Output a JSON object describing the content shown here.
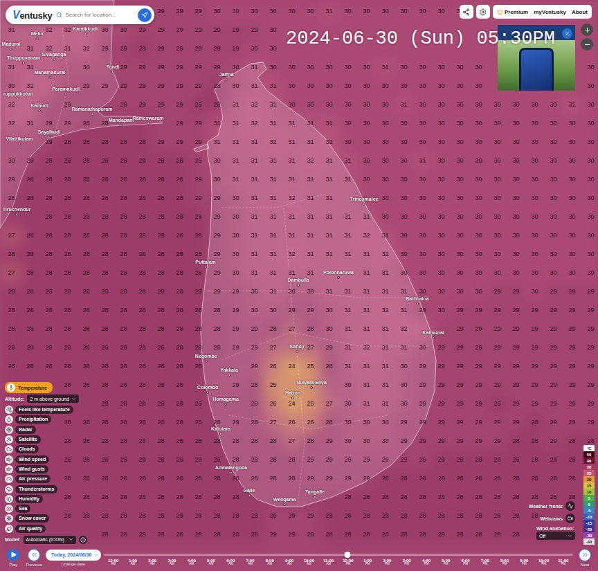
{
  "header": {
    "logo": "Ventusky",
    "search_placeholder": "Search for location...",
    "nav": [
      {
        "label": "Premium",
        "kind": "premium"
      },
      {
        "label": "myVentusky",
        "kind": "link"
      },
      {
        "label": "About",
        "kind": "link"
      }
    ]
  },
  "datetime": "2024-06-30 (Sun) 05:30PM",
  "layers": {
    "items": [
      {
        "label": "Temperature",
        "selected": true
      },
      {
        "label": "Feels like temperature",
        "selected": false
      },
      {
        "label": "Precipitation",
        "selected": false
      },
      {
        "label": "Radar",
        "selected": false
      },
      {
        "label": "Satellite",
        "selected": false
      },
      {
        "label": "Clouds",
        "selected": false
      },
      {
        "label": "Wind speed",
        "selected": false
      },
      {
        "label": "Wind gusts",
        "selected": false
      },
      {
        "label": "Air pressure",
        "selected": false
      },
      {
        "label": "Thunderstorms",
        "selected": false
      },
      {
        "label": "Humidity",
        "selected": false
      },
      {
        "label": "Sea",
        "selected": false
      },
      {
        "label": "Snow cover",
        "selected": false
      },
      {
        "label": "Air quality",
        "selected": false
      }
    ],
    "altitude": {
      "label": "Altitude:",
      "value": "2 m above ground"
    },
    "model": {
      "label": "Model:",
      "value": "Automatic (ICON)"
    }
  },
  "legend": {
    "unit": "°C",
    "items": [
      {
        "label": "50",
        "color": "#3d0716"
      },
      {
        "label": "40",
        "color": "#6b1330"
      },
      {
        "label": "30",
        "color": "#a13c63"
      },
      {
        "label": "25",
        "color": "#c9596a"
      },
      {
        "label": "20",
        "color": "#e39a3c"
      },
      {
        "label": "15",
        "color": "#d6c13a"
      },
      {
        "label": "10",
        "color": "#a5c43b"
      },
      {
        "label": "5",
        "color": "#4caf45"
      },
      {
        "label": "0",
        "color": "#2e9d7c"
      },
      {
        "label": "-5",
        "color": "#3a86c4"
      },
      {
        "label": "-10",
        "color": "#3d63b3"
      },
      {
        "label": "-15",
        "color": "#2f3f9e"
      },
      {
        "label": "-20",
        "color": "#4b2d8f"
      },
      {
        "label": "-30",
        "color": "#9a3fa6"
      },
      {
        "label": "-40",
        "color": "#e6e6e6"
      }
    ]
  },
  "map_controls": {
    "weather_fronts": "Weather fronts",
    "webcams": "Webcams",
    "wind_animation": {
      "label": "Wind animation:",
      "value": "Off"
    }
  },
  "timeline": {
    "play": "Play",
    "previous": "Previous",
    "date": "Today, 2024/06/30",
    "change_date": "Change date",
    "next": "Next",
    "level": 0.52,
    "times": [
      {
        "time": "12:00",
        "ampm": "AM"
      },
      {
        "time": "1:00",
        "ampm": "AM"
      },
      {
        "time": "2:00",
        "ampm": "AM"
      },
      {
        "time": "3:00",
        "ampm": "AM"
      },
      {
        "time": "4:00",
        "ampm": "AM"
      },
      {
        "time": "5:00",
        "ampm": "AM"
      },
      {
        "time": "6:00",
        "ampm": "AM"
      },
      {
        "time": "7:00",
        "ampm": "AM"
      },
      {
        "time": "8:00",
        "ampm": "AM"
      },
      {
        "time": "9:00",
        "ampm": "AM"
      },
      {
        "time": "10:00",
        "ampm": "AM"
      },
      {
        "time": "11:00",
        "ampm": "AM"
      },
      {
        "time": "12:00",
        "ampm": "PM"
      },
      {
        "time": "1:00",
        "ampm": "PM"
      },
      {
        "time": "2:00",
        "ampm": "PM"
      },
      {
        "time": "3:00",
        "ampm": "PM"
      },
      {
        "time": "4:00",
        "ampm": "PM"
      },
      {
        "time": "5:00",
        "ampm": "PM"
      },
      {
        "time": "6:00",
        "ampm": "PM"
      },
      {
        "time": "7:00",
        "ampm": "PM"
      },
      {
        "time": "8:00",
        "ampm": "PM"
      },
      {
        "time": "9:00",
        "ampm": "PM"
      },
      {
        "time": "10:00",
        "ampm": "PM"
      },
      {
        "time": "11:00",
        "ampm": "PM"
      }
    ]
  },
  "cities": [
    {
      "name": "Madurai"
    },
    {
      "name": "Melur"
    },
    {
      "name": "Karaikkudi"
    },
    {
      "name": "Sivaganga"
    },
    {
      "name": "Tiruppuvanam"
    },
    {
      "name": "Manamadurai"
    },
    {
      "name": "Tondi"
    },
    {
      "name": "ruppukkottai"
    },
    {
      "name": "Paramakudi"
    },
    {
      "name": "Kamudi"
    },
    {
      "name": "Ramanathapuram"
    },
    {
      "name": "Mandapam"
    },
    {
      "name": "Rameswaram"
    },
    {
      "name": "Sayalkudi"
    },
    {
      "name": "Vilattikulam"
    },
    {
      "name": "Tiruchendur"
    },
    {
      "name": "Jaffna"
    },
    {
      "name": "Trincomalee"
    },
    {
      "name": "Puttalam"
    },
    {
      "name": "Dambulla"
    },
    {
      "name": "Polonnaruwa"
    },
    {
      "name": "Batticaloa"
    },
    {
      "name": "Kalmunai"
    },
    {
      "name": "Kandy"
    },
    {
      "name": "Negombo"
    },
    {
      "name": "Yakkala"
    },
    {
      "name": "Colombo"
    },
    {
      "name": "Homagama"
    },
    {
      "name": "Nuwara Eliya"
    },
    {
      "name": "Hatton"
    },
    {
      "name": "Kalutara"
    },
    {
      "name": "Ambalangoda"
    },
    {
      "name": "Galle"
    },
    {
      "name": "Weligama"
    },
    {
      "name": "Tangalle"
    }
  ],
  "temperature_grid": [
    [
      "",
      "",
      "",
      "",
      "",
      "",
      "",
      "",
      "29",
      "29",
      "29",
      "30",
      "30",
      "30",
      "30",
      "30",
      "30",
      "31",
      "30",
      "30",
      "30",
      "30",
      "30",
      "30",
      "30",
      "",
      "",
      "",
      "",
      "",
      "",
      ""
    ],
    [
      "31",
      "",
      "32",
      "32",
      "",
      "30",
      "30",
      "29",
      "29",
      "29",
      "29",
      "29",
      "29",
      "29",
      "30",
      "",
      "",
      "",
      "",
      "",
      "",
      "",
      "",
      "",
      "",
      "",
      "",
      "",
      "",
      "",
      "",
      ""
    ],
    [
      "",
      "31",
      "32",
      "31",
      "32",
      "29",
      "29",
      "28",
      "29",
      "29",
      "29",
      "29",
      "29",
      "30",
      "30",
      "",
      "",
      "",
      "",
      "",
      "",
      "",
      "",
      "",
      "",
      "",
      "",
      "",
      "",
      "",
      "",
      ""
    ],
    [
      "31",
      "31",
      "",
      "",
      "30",
      "",
      "29",
      "29",
      "29",
      "29",
      "29",
      "29",
      "30",
      "31",
      "30",
      "30",
      "30",
      "30",
      "30",
      "30",
      "31",
      "30",
      "30",
      "30",
      "30",
      "30",
      "",
      "",
      "",
      "",
      "",
      "30"
    ],
    [
      "30",
      "32",
      "",
      "",
      "29",
      "29",
      "29",
      "29",
      "29",
      "29",
      "29",
      "28",
      "30",
      "31",
      "31",
      "30",
      "30",
      "30",
      "30",
      "30",
      "30",
      "30",
      "30",
      "30",
      "30",
      "30",
      "",
      "",
      "",
      "",
      "",
      "30"
    ],
    [
      "32",
      "",
      "",
      "29",
      "",
      "",
      "29",
      "29",
      "29",
      "29",
      "28",
      "28",
      "31",
      "32",
      "31",
      "30",
      "30",
      "30",
      "30",
      "30",
      "30",
      "31",
      "30",
      "30",
      "30",
      "30",
      "30",
      "30",
      "30",
      "30",
      "31",
      "30"
    ],
    [
      "32",
      "31",
      "29",
      "29",
      "28",
      "28",
      "",
      "",
      "",
      "29",
      "29",
      "31",
      "31",
      "32",
      "31",
      "31",
      "31",
      "31",
      "30",
      "30",
      "30",
      "30",
      "30",
      "30",
      "30",
      "30",
      "30",
      "30",
      "30",
      "30",
      "30",
      "30"
    ],
    [
      "",
      "",
      "29",
      "28",
      "28",
      "28",
      "28",
      "28",
      "29",
      "29",
      "29",
      "31",
      "31",
      "31",
      "32",
      "31",
      "31",
      "32",
      "30",
      "30",
      "30",
      "30",
      "30",
      "30",
      "30",
      "30",
      "30",
      "30",
      "30",
      "30",
      "30",
      "30"
    ],
    [
      "30",
      "29",
      "28",
      "28",
      "28",
      "28",
      "28",
      "28",
      "28",
      "28",
      "29",
      "30",
      "31",
      "31",
      "31",
      "31",
      "32",
      "31",
      "31",
      "30",
      "30",
      "30",
      "31",
      "30",
      "30",
      "30",
      "30",
      "30",
      "30",
      "30",
      "30",
      "30"
    ],
    [
      "29",
      "28",
      "28",
      "28",
      "28",
      "28",
      "28",
      "28",
      "28",
      "28",
      "29",
      "30",
      "31",
      "31",
      "31",
      "31",
      "31",
      "31",
      "31",
      "30",
      "30",
      "30",
      "30",
      "30",
      "30",
      "30",
      "30",
      "30",
      "30",
      "30",
      "30",
      "30"
    ],
    [
      "28",
      "28",
      "28",
      "28",
      "28",
      "28",
      "28",
      "28",
      "28",
      "28",
      "29",
      "29",
      "30",
      "31",
      "31",
      "32",
      "31",
      "31",
      "",
      "",
      "30",
      "30",
      "30",
      "30",
      "30",
      "30",
      "30",
      "30",
      "30",
      "30",
      "30",
      "30"
    ],
    [
      "",
      "",
      "28",
      "28",
      "28",
      "28",
      "28",
      "28",
      "28",
      "28",
      "28",
      "29",
      "30",
      "31",
      "31",
      "31",
      "31",
      "31",
      "31",
      "31",
      "30",
      "30",
      "30",
      "30",
      "30",
      "30",
      "30",
      "30",
      "30",
      "30",
      "30",
      "30"
    ],
    [
      "27",
      "28",
      "28",
      "28",
      "28",
      "28",
      "28",
      "28",
      "28",
      "28",
      "28",
      "29",
      "30",
      "31",
      "31",
      "31",
      "31",
      "31",
      "31",
      "32",
      "31",
      "30",
      "30",
      "30",
      "30",
      "30",
      "30",
      "30",
      "30",
      "30",
      "30",
      "30"
    ],
    [
      "28",
      "28",
      "28",
      "28",
      "28",
      "28",
      "28",
      "28",
      "28",
      "28",
      "28",
      "29",
      "30",
      "31",
      "31",
      "32",
      "31",
      "31",
      "31",
      "31",
      "32",
      "30",
      "30",
      "30",
      "30",
      "30",
      "30",
      "30",
      "30",
      "30",
      "30",
      "30"
    ],
    [
      "27",
      "28",
      "28",
      "28",
      "28",
      "28",
      "28",
      "28",
      "28",
      "28",
      "28",
      "29",
      "30",
      "31",
      "31",
      "31",
      "31",
      "",
      "",
      "31",
      "31",
      "30",
      "30",
      "30",
      "30",
      "30",
      "30",
      "30",
      "30",
      "30",
      "30",
      "30"
    ],
    [
      "28",
      "28",
      "28",
      "28",
      "28",
      "28",
      "28",
      "28",
      "28",
      "28",
      "28",
      "29",
      "29",
      "30",
      "31",
      "30",
      "30",
      "31",
      "31",
      "31",
      "31",
      "31",
      "30",
      "30",
      "30",
      "30",
      "29",
      "29",
      "30",
      "29",
      "29",
      "29"
    ],
    [
      "28",
      "28",
      "28",
      "28",
      "28",
      "28",
      "28",
      "28",
      "28",
      "28",
      "28",
      "28",
      "29",
      "30",
      "30",
      "29",
      "29",
      "30",
      "31",
      "31",
      "32",
      "31",
      "29",
      "30",
      "29",
      "29",
      "29",
      "29",
      "29",
      "29",
      "29",
      "29"
    ],
    [
      "28",
      "28",
      "28",
      "28",
      "28",
      "28",
      "28",
      "28",
      "28",
      "28",
      "28",
      "28",
      "29",
      "29",
      "28",
      "27",
      "28",
      "30",
      "31",
      "31",
      "31",
      "32",
      "",
      "",
      "29",
      "29",
      "29",
      "29",
      "29",
      "29",
      "29",
      "29"
    ],
    [
      "28",
      "28",
      "28",
      "28",
      "28",
      "28",
      "28",
      "28",
      "28",
      "28",
      "28",
      "28",
      "29",
      "29",
      "27",
      "",
      "27",
      "29",
      "31",
      "32",
      "31",
      "31",
      "30",
      "29",
      "29",
      "29",
      "29",
      "29",
      "29",
      "29",
      "29",
      "29"
    ],
    [
      "28",
      "28",
      "28",
      "28",
      "28",
      "28",
      "28",
      "28",
      "28",
      "28",
      "28",
      "",
      "",
      "29",
      "26",
      "24",
      "25",
      "28",
      "31",
      "31",
      "31",
      "30",
      "29",
      "29",
      "29",
      "29",
      "29",
      "29",
      "29",
      "29",
      "29",
      "29"
    ],
    [
      "",
      "",
      "",
      "28",
      "28",
      "28",
      "28",
      "28",
      "28",
      "28",
      "",
      "",
      "29",
      "28",
      "25",
      "",
      "",
      "",
      "30",
      "31",
      "31",
      "30",
      "29",
      "29",
      "29",
      "29",
      "29",
      "29",
      "29",
      "29",
      "29",
      "29"
    ],
    [
      "",
      "",
      "",
      "",
      "",
      "28",
      "28",
      "28",
      "28",
      "28",
      "28",
      "",
      "",
      "28",
      "26",
      "24",
      "25",
      "27",
      "30",
      "31",
      "31",
      "30",
      "29",
      "29",
      "29",
      "29",
      "28",
      "29",
      "29",
      "29",
      "29",
      "29"
    ],
    [
      "",
      "",
      "",
      "28",
      "28",
      "28",
      "28",
      "28",
      "28",
      "28",
      "28",
      "28",
      "29",
      "28",
      "27",
      "26",
      "26",
      "28",
      "30",
      "30",
      "30",
      "29",
      "29",
      "29",
      "29",
      "29",
      "29",
      "29",
      "28",
      "29",
      "29",
      "29"
    ],
    [
      "",
      "",
      "",
      "28",
      "28",
      "28",
      "28",
      "28",
      "28",
      "28",
      "28",
      "28",
      "28",
      "28",
      "28",
      "27",
      "28",
      "29",
      "30",
      "30",
      "30",
      "29",
      "29",
      "29",
      "29",
      "29",
      "29",
      "28",
      "28",
      "29",
      "28",
      "28"
    ],
    [
      "",
      "",
      "",
      "28",
      "28",
      "28",
      "28",
      "28",
      "28",
      "28",
      "28",
      "28",
      "28",
      "28",
      "28",
      "28",
      "29",
      "29",
      "29",
      "29",
      "29",
      "29",
      "29",
      "28",
      "28",
      "28",
      "28",
      "28",
      "28",
      "28",
      "28",
      ""
    ],
    [
      "",
      "",
      "",
      "28",
      "28",
      "28",
      "28",
      "28",
      "28",
      "28",
      "28",
      "28",
      "28",
      "28",
      "28",
      "28",
      "29",
      "29",
      "29",
      "29",
      "28",
      "28",
      "28",
      "28",
      "28",
      "28",
      "28",
      "28",
      "28",
      "28",
      "28",
      ""
    ],
    [
      "",
      "",
      "",
      "28",
      "28",
      "28",
      "28",
      "28",
      "28",
      "28",
      "28",
      "28",
      "28",
      "",
      "",
      "",
      "",
      "",
      "28",
      "28",
      "28",
      "28",
      "28",
      "28",
      "28",
      "28",
      "28",
      "28",
      "28",
      "28",
      "28",
      ""
    ],
    [
      "",
      "",
      "",
      "28",
      "28",
      "28",
      "28",
      "28",
      "28",
      "28",
      "28",
      "28",
      "28",
      "28",
      "29",
      "29",
      "29",
      "28",
      "28",
      "28",
      "28",
      "28",
      "28",
      "28",
      "28",
      "28",
      "28",
      "28",
      "28",
      "",
      "",
      ""
    ],
    [
      "",
      "",
      "",
      "",
      "",
      "28",
      "28",
      "28",
      "28",
      "28",
      "28",
      "28",
      "28",
      "28",
      "29",
      "29",
      "29",
      "28",
      "28",
      "28",
      "28",
      "28",
      "28",
      "28",
      "28",
      "28",
      "28",
      "28",
      "",
      "",
      "",
      ""
    ]
  ]
}
